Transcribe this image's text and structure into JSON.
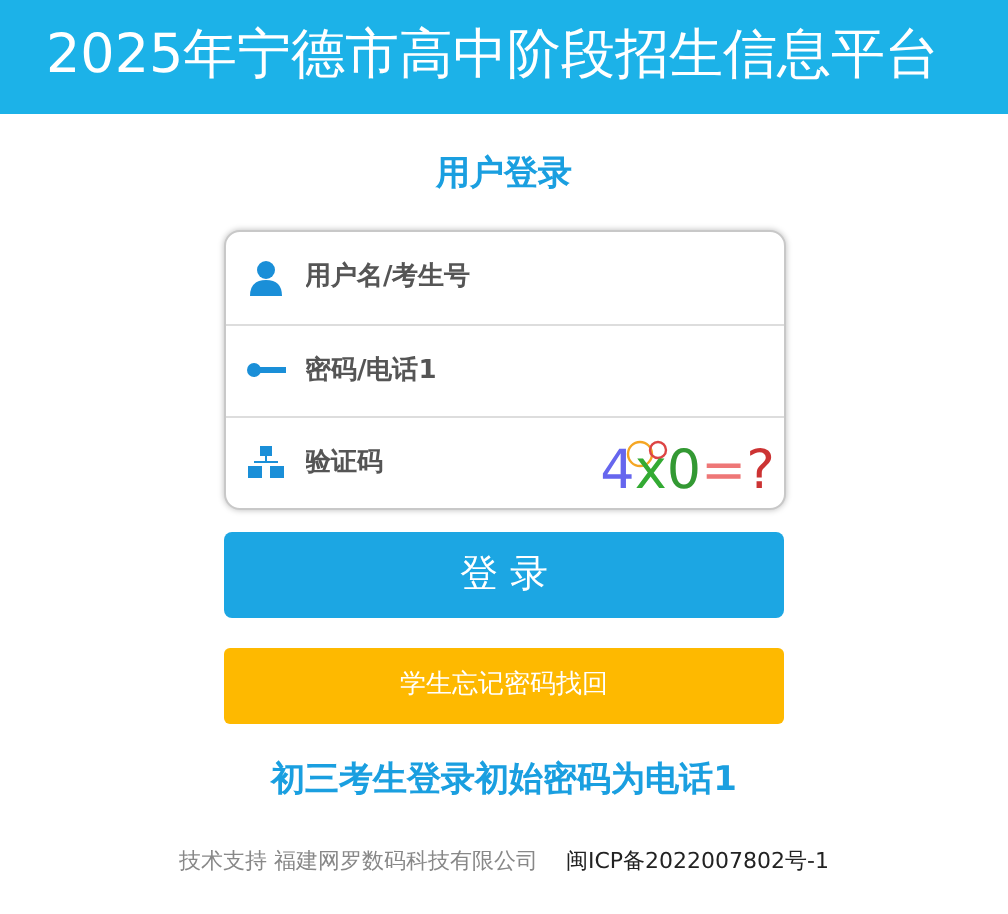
{
  "header": {
    "title": "2025年宁德市高中阶段招生信息平台"
  },
  "login": {
    "title": "用户登录",
    "fields": [
      {
        "kind": "user",
        "placeholder": "用户名/考生号"
      },
      {
        "kind": "key",
        "placeholder": "密码/电话1"
      },
      {
        "kind": "captcha",
        "placeholder": "验证码",
        "captcha": [
          {
            "char": "4",
            "color": "#6666ee"
          },
          {
            "char": "x",
            "color": "#33aa33"
          },
          {
            "char": "0",
            "color": "#339933"
          },
          {
            "char": "=",
            "color": "#ee7777"
          },
          {
            "char": "?",
            "color": "#cc3333"
          }
        ]
      }
    ],
    "login_button": "登 录",
    "forgot_button": "学生忘记密码找回",
    "notice": "初三考生登录初始密码为电话1"
  },
  "footer": {
    "support": "技术支持 福建网罗数码科技有限公司",
    "icp": "闽ICP备2022007802号-1"
  }
}
